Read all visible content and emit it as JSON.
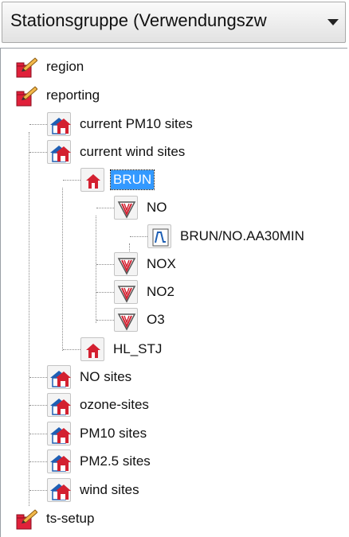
{
  "dropdown": {
    "label": "Stationsgruppe (Verwendungszw",
    "arrow_icon": "triangle-down-icon"
  },
  "tree": {
    "items": [
      {
        "label": "region",
        "icon": "folder-pencil-icon"
      },
      {
        "label": "reporting",
        "icon": "folder-pencil-icon"
      },
      {
        "label": "current PM10 sites",
        "icon": "station-group-icon"
      },
      {
        "label": "current wind sites",
        "icon": "station-group-icon"
      },
      {
        "label": "BRUN",
        "icon": "station-icon",
        "selected": true
      },
      {
        "label": "NO",
        "icon": "component-icon"
      },
      {
        "label": "BRUN/NO.AA30MIN",
        "icon": "timeseries-icon"
      },
      {
        "label": "NOX",
        "icon": "component-icon"
      },
      {
        "label": "NO2",
        "icon": "component-icon"
      },
      {
        "label": "O3",
        "icon": "component-icon"
      },
      {
        "label": "HL_STJ",
        "icon": "station-icon"
      },
      {
        "label": "NO sites",
        "icon": "station-group-icon"
      },
      {
        "label": "ozone-sites",
        "icon": "station-group-icon"
      },
      {
        "label": "PM10 sites",
        "icon": "station-group-icon"
      },
      {
        "label": "PM2.5 sites",
        "icon": "station-group-icon"
      },
      {
        "label": "wind sites",
        "icon": "station-group-icon"
      },
      {
        "label": "ts-setup",
        "icon": "folder-pencil-icon"
      }
    ]
  },
  "colors": {
    "selection": "#3399ff",
    "folder_red": "#e0203a",
    "house_blue": "#1e5fb4"
  }
}
